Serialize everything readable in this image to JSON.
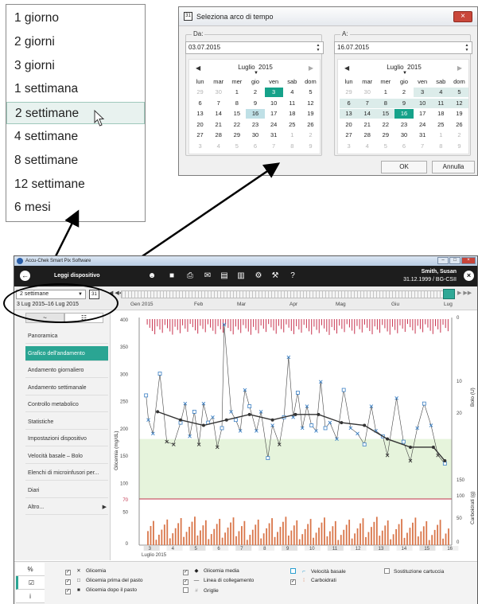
{
  "dropdown": {
    "options": [
      "1 giorno",
      "2 giorni",
      "3 giorni",
      "1 settimana",
      "2 settimane",
      "4 settimane",
      "8 settimane",
      "12 settimane",
      "6 mesi"
    ],
    "selected_index": 4
  },
  "dialog": {
    "title": "Seleziona arco di tempo",
    "close": "×",
    "from": {
      "label": "Da:",
      "date": "03.07.2015",
      "month_label": "Luglio",
      "year": "2015",
      "weekdays": [
        "lun",
        "mar",
        "mer",
        "gio",
        "ven",
        "sab",
        "dom"
      ],
      "weeks": [
        [
          "29",
          "30",
          "1",
          "2",
          "3",
          "4",
          "5"
        ],
        [
          "6",
          "7",
          "8",
          "9",
          "10",
          "11",
          "12"
        ],
        [
          "13",
          "14",
          "15",
          "16",
          "17",
          "18",
          "19"
        ],
        [
          "20",
          "21",
          "22",
          "23",
          "24",
          "25",
          "26"
        ],
        [
          "27",
          "28",
          "29",
          "30",
          "31",
          "1",
          "2"
        ],
        [
          "3",
          "4",
          "5",
          "6",
          "7",
          "8",
          "9"
        ]
      ]
    },
    "to": {
      "label": "A:",
      "date": "16.07.2015",
      "month_label": "Luglio",
      "year": "2015",
      "weekdays": [
        "lun",
        "mar",
        "mer",
        "gio",
        "ven",
        "sab",
        "dom"
      ],
      "weeks": [
        [
          "29",
          "30",
          "1",
          "2",
          "3",
          "4",
          "5"
        ],
        [
          "6",
          "7",
          "8",
          "9",
          "10",
          "11",
          "12"
        ],
        [
          "13",
          "14",
          "15",
          "16",
          "17",
          "18",
          "19"
        ],
        [
          "20",
          "21",
          "22",
          "23",
          "24",
          "25",
          "26"
        ],
        [
          "27",
          "28",
          "29",
          "30",
          "31",
          "1",
          "2"
        ],
        [
          "3",
          "4",
          "5",
          "6",
          "7",
          "8",
          "9"
        ]
      ]
    },
    "ok": "OK",
    "cancel": "Annulla"
  },
  "app": {
    "title": "Accu-Chek Smart Pix Software",
    "toolbar_label": "Leggi dispositivo",
    "patient_name": "Smith, Susan",
    "patient_info": "31.12.1999 / BG-CSII",
    "period_select": "2 settimane",
    "calendar_icon": "31",
    "range_text": "3 Lug 2015–16 Lug 2015",
    "timeline_months": [
      "Gen 2015",
      "Feb",
      "Mar",
      "Apr",
      "Mag",
      "Giu",
      "Lug"
    ],
    "sidebar_tabs": [
      "~",
      "☷"
    ],
    "nav": [
      "Panoramica",
      "Grafico dell'andamento",
      "Andamento giornaliero",
      "Andamento settimanale",
      "Controllo metabolico",
      "Statistiche",
      "Impostazioni dispositivo",
      "Velocità basale – Bolo",
      "Elenchi di microinfusori per...",
      "Diari",
      "Altro..."
    ],
    "nav_active_index": 1,
    "legend_tabs": [
      "%",
      "☑",
      "i"
    ],
    "legend": {
      "glicemia": "Glicemia",
      "glicemia_prima": "Glicemia prima del pasto",
      "glicemia_dopo": "Glicemia dopo il pasto",
      "glicemia_media": "Glicemia media",
      "linea": "Linea di collegamento",
      "griglie": "Griglie",
      "velocita": "Velocità basale",
      "carboidrati": "Carboidrati",
      "sostituzione": "Sostituzione cartuccia"
    }
  },
  "colors": {
    "accent": "#2aa593",
    "target_band": "#e6f4dc",
    "hypo_line": "#c0304a",
    "bolus": "#c8324e",
    "carbs": "#d9764a",
    "mean": "#333333",
    "bg_x": "#3a7fc4"
  },
  "chart_data": {
    "type": "line",
    "ylabel_left": "Glicemia (mg/dL)",
    "ylabel_right_top": "Bolo (U)",
    "ylabel_right_bottom": "Carboidrati (g)",
    "x_tick_labels": [
      "3",
      "4",
      "5",
      "6",
      "7",
      "8",
      "9",
      "10",
      "11",
      "12",
      "13",
      "14",
      "15",
      "16"
    ],
    "x_caption": "Luglio 2015",
    "y_ticks_left": [
      "400",
      "350",
      "300",
      "250",
      "200",
      "150",
      "100",
      "70",
      "50",
      "0"
    ],
    "hypo_label": "70",
    "y_ticks_right_bolus": [
      "0",
      "10",
      "20"
    ],
    "y_ticks_right_carbs": [
      "150",
      "100",
      "50",
      "0"
    ],
    "target_range": [
      70,
      180
    ],
    "hypo_threshold": 70,
    "series": [
      {
        "name": "Glicemia",
        "points": [
          [
            3.0,
            260
          ],
          [
            3.1,
            215
          ],
          [
            3.3,
            190
          ],
          [
            3.6,
            300
          ],
          [
            3.9,
            175
          ],
          [
            4.2,
            170
          ],
          [
            4.5,
            210
          ],
          [
            4.7,
            245
          ],
          [
            4.9,
            185
          ],
          [
            5.1,
            230
          ],
          [
            5.3,
            170
          ],
          [
            5.5,
            245
          ],
          [
            5.7,
            210
          ],
          [
            5.9,
            220
          ],
          [
            6.1,
            165
          ],
          [
            6.3,
            200
          ],
          [
            6.4,
            390
          ],
          [
            6.7,
            230
          ],
          [
            6.9,
            215
          ],
          [
            7.1,
            195
          ],
          [
            7.3,
            270
          ],
          [
            7.5,
            240
          ],
          [
            7.8,
            195
          ],
          [
            8.0,
            230
          ],
          [
            8.3,
            145
          ],
          [
            8.5,
            205
          ],
          [
            8.8,
            170
          ],
          [
            9.0,
            220
          ],
          [
            9.2,
            330
          ],
          [
            9.4,
            220
          ],
          [
            9.6,
            265
          ],
          [
            9.8,
            200
          ],
          [
            10.0,
            240
          ],
          [
            10.2,
            205
          ],
          [
            10.4,
            195
          ],
          [
            10.6,
            285
          ],
          [
            10.8,
            200
          ],
          [
            11.0,
            210
          ],
          [
            11.3,
            180
          ],
          [
            11.6,
            270
          ],
          [
            11.9,
            200
          ],
          [
            12.2,
            190
          ],
          [
            12.5,
            170
          ],
          [
            12.8,
            240
          ],
          [
            13.0,
            195
          ],
          [
            13.3,
            185
          ],
          [
            13.5,
            150
          ],
          [
            13.9,
            255
          ],
          [
            14.2,
            175
          ],
          [
            14.5,
            140
          ],
          [
            14.8,
            200
          ],
          [
            15.1,
            245
          ],
          [
            15.4,
            205
          ],
          [
            15.7,
            150
          ],
          [
            16.0,
            135
          ]
        ]
      },
      {
        "name": "Glicemia media",
        "points": [
          [
            3.5,
            230
          ],
          [
            4.5,
            215
          ],
          [
            5.5,
            205
          ],
          [
            6.5,
            215
          ],
          [
            7.5,
            225
          ],
          [
            8.5,
            215
          ],
          [
            9.5,
            225
          ],
          [
            10.5,
            225
          ],
          [
            11.5,
            210
          ],
          [
            12.5,
            205
          ],
          [
            13.5,
            180
          ],
          [
            14.5,
            165
          ],
          [
            15.5,
            165
          ],
          [
            16.0,
            140
          ]
        ]
      }
    ]
  }
}
